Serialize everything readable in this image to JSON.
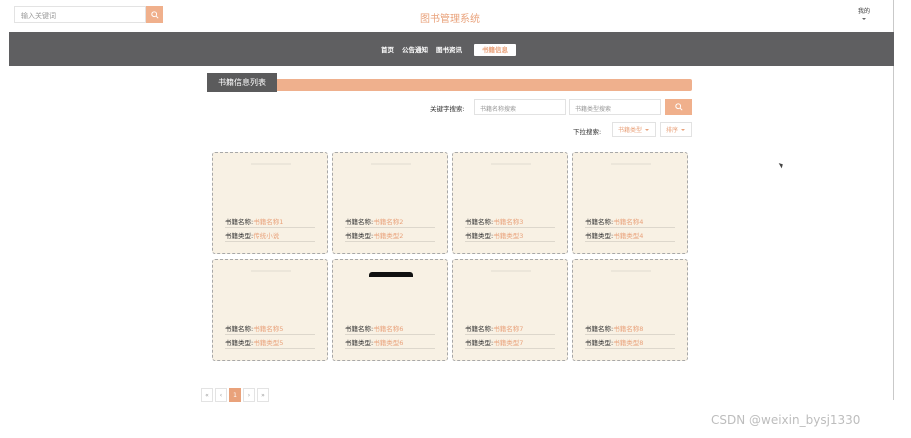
{
  "header": {
    "search_placeholder": "输入关键词",
    "site_title": "图书管理系统",
    "user_menu": "我的"
  },
  "nav": {
    "items": [
      "首页",
      "公告通知",
      "图书资讯"
    ],
    "active": "书籍信息"
  },
  "section": {
    "title": "书籍信息列表"
  },
  "filters": {
    "keyword_label": "关键字搜索:",
    "name_placeholder": "书籍名称搜索",
    "type_placeholder": "书籍类型搜索",
    "dropdown_label": "下拉搜索:",
    "type_dropdown": "书籍类型",
    "sort_dropdown": "排序"
  },
  "books": [
    {
      "name_label": "书籍名称:",
      "name": "书籍名称1",
      "type_label": "书籍类型:",
      "type": "传统小说"
    },
    {
      "name_label": "书籍名称:",
      "name": "书籍名称2",
      "type_label": "书籍类型:",
      "type": "书籍类型2"
    },
    {
      "name_label": "书籍名称:",
      "name": "书籍名称3",
      "type_label": "书籍类型:",
      "type": "书籍类型3"
    },
    {
      "name_label": "书籍名称:",
      "name": "书籍名称4",
      "type_label": "书籍类型:",
      "type": "书籍类型4"
    },
    {
      "name_label": "书籍名称:",
      "name": "书籍名称5",
      "type_label": "书籍类型:",
      "type": "书籍类型5"
    },
    {
      "name_label": "书籍名称:",
      "name": "书籍名称6",
      "type_label": "书籍类型:",
      "type": "书籍类型6"
    },
    {
      "name_label": "书籍名称:",
      "name": "书籍名称7",
      "type_label": "书籍类型:",
      "type": "书籍类型7"
    },
    {
      "name_label": "书籍名称:",
      "name": "书籍名称8",
      "type_label": "书籍类型:",
      "type": "书籍类型8"
    }
  ],
  "pagination": {
    "first": "«",
    "prev": "‹",
    "current": "1",
    "next": "›",
    "last": "»"
  },
  "watermark": "CSDN @weixin_bysj1330",
  "icons": {
    "search": "search-icon"
  },
  "colors": {
    "accent": "#e9a27b",
    "nav_bg": "#5f5f61",
    "card_bg": "#f8f1e4"
  }
}
